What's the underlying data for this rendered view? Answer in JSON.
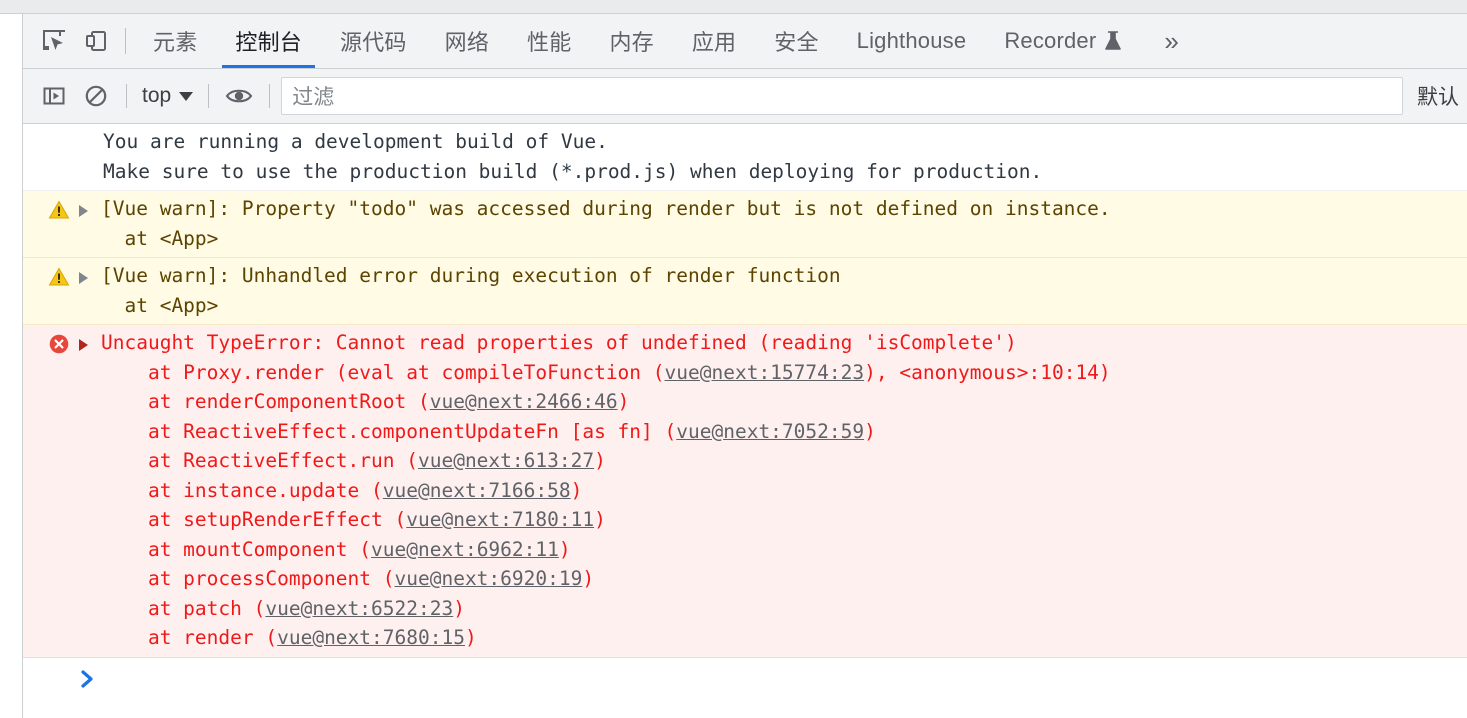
{
  "window": {
    "title": "Chrome DevTools - Console"
  },
  "tabbar": {
    "inspect_icon": "inspect-element-icon",
    "device_icon": "device-toolbar-icon",
    "tabs": [
      {
        "label": "元素",
        "active": false
      },
      {
        "label": "控制台",
        "active": true
      },
      {
        "label": "源代码",
        "active": false
      },
      {
        "label": "网络",
        "active": false
      },
      {
        "label": "性能",
        "active": false
      },
      {
        "label": "内存",
        "active": false
      },
      {
        "label": "应用",
        "active": false
      },
      {
        "label": "安全",
        "active": false
      },
      {
        "label": "Lighthouse",
        "active": false
      },
      {
        "label": "Recorder",
        "active": false,
        "icon": "flask-icon"
      }
    ],
    "more_label": "»"
  },
  "console_toolbar": {
    "sidebar_toggle_icon": "console-sidebar-icon",
    "clear_icon": "clear-console-icon",
    "context_value": "top",
    "eye_icon": "live-expression-eye-icon",
    "filter_placeholder": "过滤",
    "filter_value": "",
    "levels_label": "默认"
  },
  "console": {
    "messages": [
      {
        "level": "info",
        "icon": "none",
        "expandable": false,
        "lines": [
          "You are running a development build of Vue.",
          "Make sure to use the production build (*.prod.js) when deploying for production."
        ]
      },
      {
        "level": "warn",
        "icon": "warning-triangle-icon",
        "expandable": true,
        "lines": [
          "[Vue warn]: Property \"todo\" was accessed during render but is not defined on instance.",
          "  at <App>"
        ]
      },
      {
        "level": "warn",
        "icon": "warning-triangle-icon",
        "expandable": true,
        "lines": [
          "[Vue warn]: Unhandled error during execution of render function",
          "  at <App>"
        ]
      },
      {
        "level": "error",
        "icon": "error-circle-icon",
        "expandable": true,
        "title": "Uncaught TypeError: Cannot read properties of undefined (reading 'isComplete')",
        "stack": [
          {
            "prefix": "    at Proxy.render (eval at compileToFunction (",
            "link": "vue@next:15774:23",
            "suffix": "), <anonymous>:10:14)"
          },
          {
            "prefix": "    at renderComponentRoot (",
            "link": "vue@next:2466:46",
            "suffix": ")"
          },
          {
            "prefix": "    at ReactiveEffect.componentUpdateFn [as fn] (",
            "link": "vue@next:7052:59",
            "suffix": ")"
          },
          {
            "prefix": "    at ReactiveEffect.run (",
            "link": "vue@next:613:27",
            "suffix": ")"
          },
          {
            "prefix": "    at instance.update (",
            "link": "vue@next:7166:58",
            "suffix": ")"
          },
          {
            "prefix": "    at setupRenderEffect (",
            "link": "vue@next:7180:11",
            "suffix": ")"
          },
          {
            "prefix": "    at mountComponent (",
            "link": "vue@next:6962:11",
            "suffix": ")"
          },
          {
            "prefix": "    at processComponent (",
            "link": "vue@next:6920:19",
            "suffix": ")"
          },
          {
            "prefix": "    at patch (",
            "link": "vue@next:6522:23",
            "suffix": ")"
          },
          {
            "prefix": "    at render (",
            "link": "vue@next:7680:15",
            "suffix": ")"
          }
        ]
      }
    ],
    "prompt_symbol": "›",
    "prompt_value": ""
  },
  "colors": {
    "accent": "#1a73e8",
    "toolbar_bg": "#f1f3f4",
    "warn_bg": "#fffbe5",
    "warn_text": "#5c4400",
    "error_bg": "#fff0f0",
    "error_text": "#f01919",
    "link": "#5f6368",
    "info_text": "#303942"
  }
}
